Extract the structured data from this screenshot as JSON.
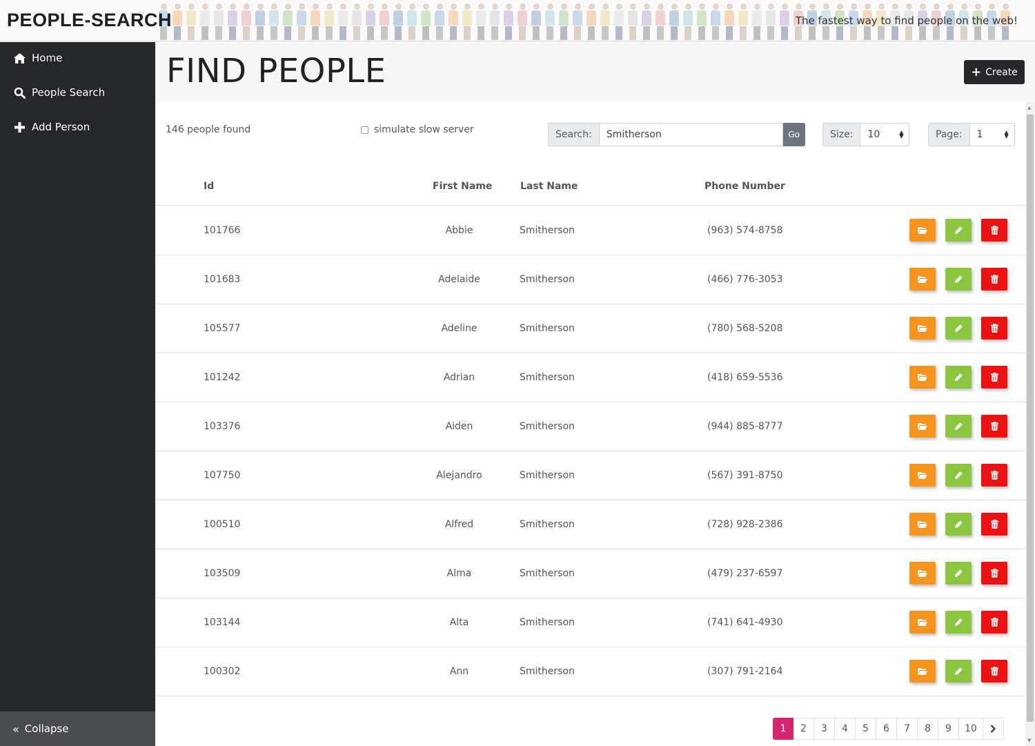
{
  "header": {
    "brand": "PEOPLE-SEARCH",
    "tagline": "The fastest way to find people on the web!"
  },
  "sidebar": {
    "items": [
      {
        "label": "Home",
        "icon": "home-icon"
      },
      {
        "label": "People Search",
        "icon": "search-icon"
      },
      {
        "label": "Add Person",
        "icon": "plus-icon"
      }
    ],
    "collapse_label": "Collapse"
  },
  "page": {
    "title": "FIND PEOPLE",
    "create_label": "Create"
  },
  "filters": {
    "found_text": "146 people found",
    "slow_label": "simulate slow server",
    "slow_checked": false,
    "search_label": "Search:",
    "search_value": "Smitherson",
    "go_label": "Go",
    "size_label": "Size:",
    "size_value": "10",
    "page_label": "Page:",
    "page_value": "1"
  },
  "table": {
    "columns": {
      "id": "Id",
      "first": "First Name",
      "last": "Last Name",
      "phone": "Phone Number"
    },
    "rows": [
      {
        "id": "101766",
        "first": "Abbie",
        "last": "Smitherson",
        "phone": "(963) 574-8758"
      },
      {
        "id": "101683",
        "first": "Adelaide",
        "last": "Smitherson",
        "phone": "(466) 776-3053"
      },
      {
        "id": "105577",
        "first": "Adeline",
        "last": "Smitherson",
        "phone": "(780) 568-5208"
      },
      {
        "id": "101242",
        "first": "Adrian",
        "last": "Smitherson",
        "phone": "(418) 659-5536"
      },
      {
        "id": "103376",
        "first": "Aiden",
        "last": "Smitherson",
        "phone": "(944) 885-8777"
      },
      {
        "id": "107750",
        "first": "Alejandro",
        "last": "Smitherson",
        "phone": "(567) 391-8750"
      },
      {
        "id": "100510",
        "first": "Alfred",
        "last": "Smitherson",
        "phone": "(728) 928-2386"
      },
      {
        "id": "103509",
        "first": "Alma",
        "last": "Smitherson",
        "phone": "(479) 237-6597"
      },
      {
        "id": "103144",
        "first": "Alta",
        "last": "Smitherson",
        "phone": "(741) 641-4930"
      },
      {
        "id": "100302",
        "first": "Ann",
        "last": "Smitherson",
        "phone": "(307) 791-2164"
      }
    ]
  },
  "pagination": {
    "pages": [
      "1",
      "2",
      "3",
      "4",
      "5",
      "6",
      "7",
      "8",
      "9",
      "10"
    ],
    "active": "1",
    "next_icon": "chevron-right-icon"
  },
  "colors": {
    "sidebar": "#25272b",
    "view": "#f7941e",
    "edit": "#8cc63f",
    "delete": "#ee1111",
    "active_page": "#d6246e"
  }
}
